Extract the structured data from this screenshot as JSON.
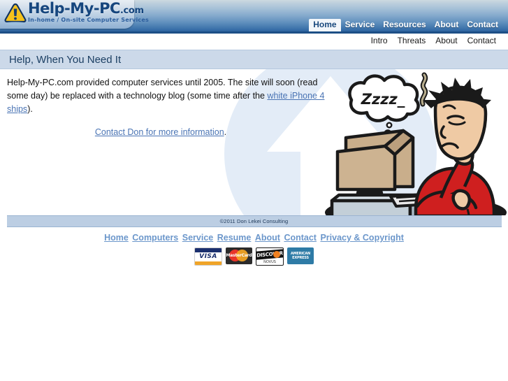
{
  "brand": {
    "logo_icon": "warning-triangle-icon",
    "name": "Help-My-PC",
    "tld": ".com",
    "tagline": "In-home / On-site Computer Services"
  },
  "header": {
    "main_nav": [
      {
        "label": "Home",
        "active": true
      },
      {
        "label": "Service",
        "active": false
      },
      {
        "label": "Resources",
        "active": false
      },
      {
        "label": "About",
        "active": false
      },
      {
        "label": "Contact",
        "active": false
      }
    ],
    "sub_nav": [
      {
        "label": "Intro"
      },
      {
        "label": "Threats"
      },
      {
        "label": "About"
      },
      {
        "label": "Contact"
      }
    ]
  },
  "page": {
    "title": "Help, When You Need It"
  },
  "main": {
    "paragraph_part1": "Help-My-PC.com provided computer services until 2005. The site will soon (read some day) be replaced with a technology blog (some time after the ",
    "paragraph_link": "white iPhone 4 ships",
    "paragraph_part2": ").",
    "contact_link": "Contact Don for more information",
    "contact_period": ".",
    "illustration": "sleeping-man-at-computer-cartoon",
    "thought_bubble_text": "Zzzz_",
    "watermark": "arrow-in-circle-watermark"
  },
  "footer": {
    "copyright": "©2011 Don Lekei Consulting",
    "links": [
      {
        "label": "Home"
      },
      {
        "label": "Computers"
      },
      {
        "label": "Service"
      },
      {
        "label": "Resume"
      },
      {
        "label": "About"
      },
      {
        "label": "Contact"
      },
      {
        "label": "Privacy & Copyright"
      }
    ],
    "cards": [
      {
        "name": "visa-card-logo",
        "label": "VISA"
      },
      {
        "name": "mastercard-card-logo",
        "label": "MasterCard"
      },
      {
        "name": "discover-card-logo",
        "label": "DISCOVER",
        "sub": "NOVUS"
      },
      {
        "name": "amex-card-logo",
        "label": "AMERICAN EXPRESS"
      }
    ]
  },
  "colors": {
    "header_dark_blue": "#1d4f86",
    "titlebar_blue": "#ccd9e9",
    "footer_bar_blue": "#bccee3",
    "link_blue": "#4a74b4",
    "footer_link_blue": "#6c97cb",
    "brand_navy": "#16467e",
    "watermark_blue": "#e3ecf7"
  }
}
